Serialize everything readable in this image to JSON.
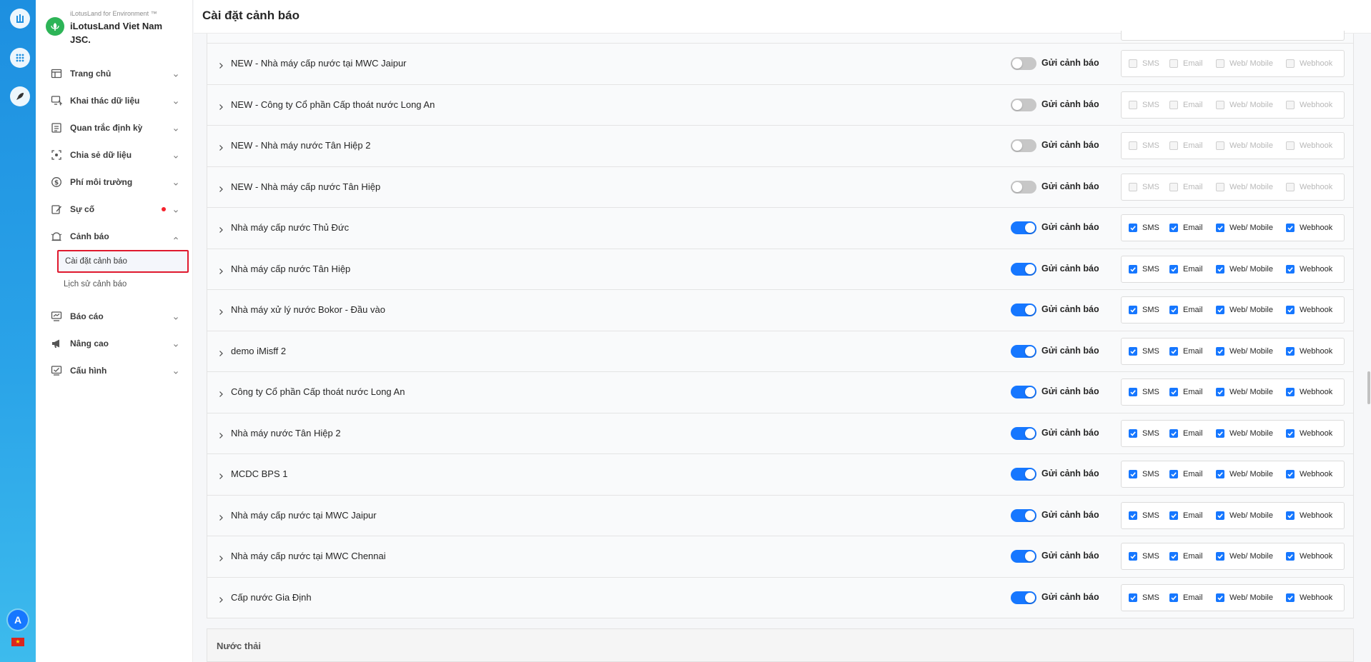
{
  "brand": {
    "subtitle": "iLotusLand for Environment ™",
    "name": "iLotusLand Viet Nam JSC."
  },
  "rail": {
    "avatar_letter": "A",
    "icons": [
      "lotus-app-icon",
      "apps-grid-icon",
      "rocket-icon"
    ]
  },
  "sidebar": {
    "items": [
      {
        "label": "Trang chủ",
        "icon": "dashboard-icon"
      },
      {
        "label": "Khai thác dữ liệu",
        "icon": "monitor-data-icon"
      },
      {
        "label": "Quan trắc định kỳ",
        "icon": "document-icon"
      },
      {
        "label": "Chia sẻ dữ liệu",
        "icon": "share-focus-icon"
      },
      {
        "label": "Phí môi trường",
        "icon": "dollar-icon"
      },
      {
        "label": "Sự cố",
        "icon": "incident-edit-icon",
        "notification_dot": true
      },
      {
        "label": "Cảnh báo",
        "icon": "alarm-bell-icon",
        "expanded": true
      },
      {
        "label": "Báo cáo",
        "icon": "report-icon"
      },
      {
        "label": "Nâng cao",
        "icon": "megaphone-icon"
      },
      {
        "label": "Cấu hình",
        "icon": "settings-screen-icon"
      }
    ],
    "submenu": [
      {
        "label": "Cài đặt cảnh báo",
        "active": true
      },
      {
        "label": "Lịch sử cảnh báo",
        "active": false
      }
    ]
  },
  "header": {
    "title": "Cài đặt cảnh báo"
  },
  "labels": {
    "send_alert": "Gửi cảnh báo",
    "channels": [
      "SMS",
      "Email",
      "Web/ Mobile",
      "Webhook"
    ]
  },
  "stations": [
    {
      "name": "NEW - Nhà máy cấp nước tại MWC Jaipur",
      "enabled": false
    },
    {
      "name": "NEW - Công ty Cổ phần Cấp thoát nước Long An",
      "enabled": false
    },
    {
      "name": "NEW - Nhà máy nước Tân Hiệp 2",
      "enabled": false
    },
    {
      "name": "NEW - Nhà máy cấp nước Tân Hiệp",
      "enabled": false
    },
    {
      "name": "Nhà máy cấp nước Thủ Đức",
      "enabled": true
    },
    {
      "name": "Nhà máy cấp nước Tân Hiệp",
      "enabled": true
    },
    {
      "name": "Nhà máy xử lý nước Bokor - Đầu vào",
      "enabled": true
    },
    {
      "name": "demo iMisff 2",
      "enabled": true
    },
    {
      "name": "Công ty Cổ phần Cấp thoát nước Long An",
      "enabled": true
    },
    {
      "name": "Nhà máy nước Tân Hiệp 2",
      "enabled": true
    },
    {
      "name": "MCDC BPS 1",
      "enabled": true
    },
    {
      "name": "Nhà máy cấp nước tại MWC Jaipur",
      "enabled": true
    },
    {
      "name": "Nhà máy cấp nước tại MWC Chennai",
      "enabled": true
    },
    {
      "name": "Cấp nước Gia Định",
      "enabled": true
    }
  ],
  "next_section": {
    "title": "Nước thải"
  },
  "colors": {
    "accent": "#1677ff",
    "active_outline": "#e0192e",
    "rail_top": "#1d8fe0",
    "rail_bottom": "#3dbbed"
  }
}
